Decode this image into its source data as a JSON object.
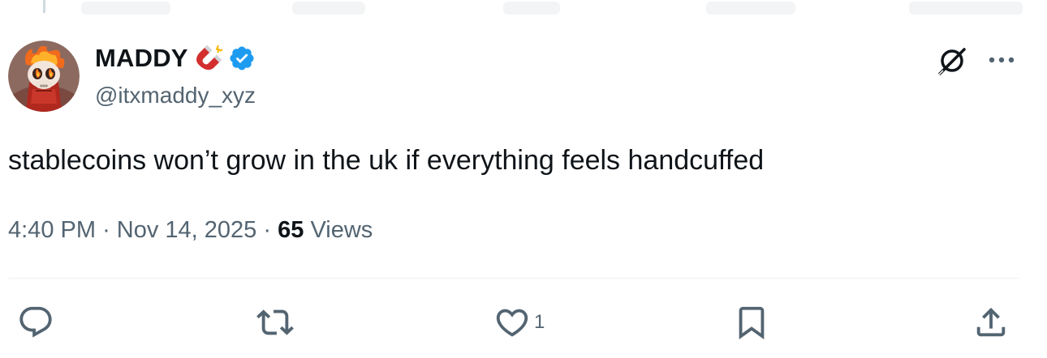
{
  "author": {
    "display_name": "MADDY",
    "handle": "@itxmaddy_xyz",
    "name_emoji": "magnet-icon",
    "verified_icon": "verified-badge-icon"
  },
  "header_actions": {
    "grok": "grok-icon",
    "more": "more-icon"
  },
  "tweet": {
    "text": "stablecoins won’t grow in the uk if everything feels handcuffed"
  },
  "meta": {
    "time": "4:40 PM",
    "separator": "·",
    "date": "Nov 14, 2025",
    "views_count": "65",
    "views_label": "Views"
  },
  "actions": {
    "reply": {
      "icon": "reply-icon",
      "count": ""
    },
    "repost": {
      "icon": "repost-icon",
      "count": ""
    },
    "like": {
      "icon": "like-icon",
      "count": "1"
    },
    "bookmark": {
      "icon": "bookmark-icon",
      "count": ""
    },
    "share": {
      "icon": "share-icon",
      "count": ""
    }
  },
  "colors": {
    "text_primary": "#0f1419",
    "text_secondary": "#536471",
    "verified_blue": "#1d9bf0",
    "divider": "#eff3f4"
  }
}
